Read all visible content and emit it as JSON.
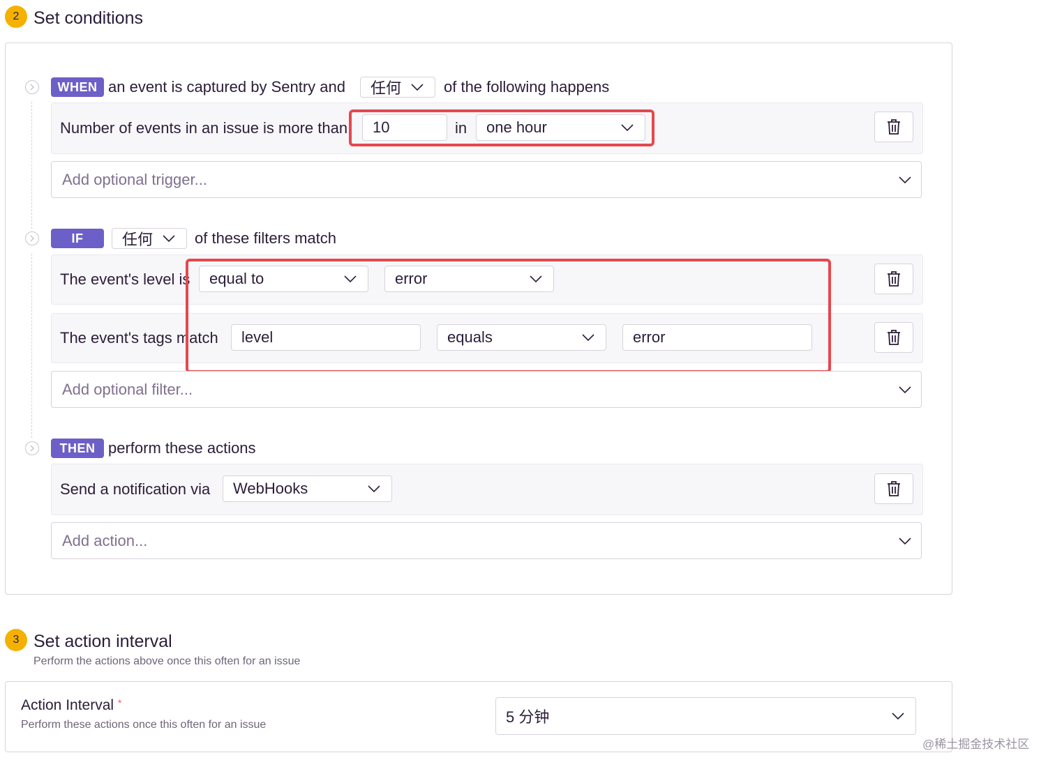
{
  "step2": {
    "number": "2",
    "title": "Set conditions"
  },
  "when": {
    "tag": "WHEN",
    "prefix": "an event is captured by Sentry and",
    "match_value": "任何",
    "suffix": "of the following happens",
    "condition": {
      "label": "Number of events in an issue is more than",
      "count_value": "10",
      "in_label": "in",
      "interval_value": "one hour"
    },
    "add_placeholder": "Add optional trigger..."
  },
  "if": {
    "tag": "IF",
    "match_value": "任何",
    "suffix": "of these filters match",
    "filters": [
      {
        "label": "The event's level is",
        "operator": "equal to",
        "value": "error"
      },
      {
        "label": "The event's tags match",
        "key": "level",
        "operator": "equals",
        "value": "error"
      }
    ],
    "add_placeholder": "Add optional filter..."
  },
  "then": {
    "tag": "THEN",
    "suffix": "perform these actions",
    "action": {
      "label": "Send a notification via",
      "service": "WebHooks"
    },
    "add_placeholder": "Add action..."
  },
  "step3": {
    "number": "3",
    "title": "Set action interval",
    "subtitle": "Perform the actions above once this often for an issue"
  },
  "interval": {
    "label": "Action Interval",
    "required_mark": "*",
    "help": "Perform these actions once this often for an issue",
    "value": "5 分钟"
  },
  "watermark": "@稀土掘金技术社区",
  "colors": {
    "accent": "#6c5fc7",
    "badge": "#f5b100",
    "highlight": "#e5484d"
  }
}
